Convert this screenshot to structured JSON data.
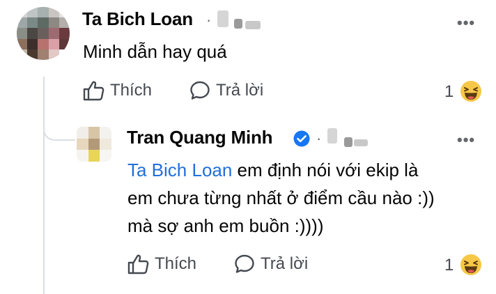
{
  "comment": {
    "author": "Ta Bich Loan",
    "separator": "·",
    "text": "Minh dẫn hay quá",
    "actions": {
      "like_label": "Thích",
      "reply_label": "Trả lời"
    },
    "reaction_count": "1",
    "more_label": "•••"
  },
  "reply": {
    "author": "Tran Quang Minh",
    "separator": "·",
    "mention": "Ta Bich Loan",
    "text_line1": " em định nói với ekip là",
    "text_line2": "em chưa từng nhất ở điểm cầu nào :))",
    "text_line3": "mà sợ anh em buồn :))))",
    "actions": {
      "like_label": "Thích",
      "reply_label": "Trả lời"
    },
    "reaction_count": "1",
    "more_label": "•••"
  },
  "colors": {
    "text": "#050505",
    "secondary": "#65676b",
    "mention": "#216fdb",
    "verified_badge": "#1877f2"
  },
  "icons": [
    "thumbs-up-icon",
    "speech-bubble-icon",
    "laughing-emoji-icon",
    "verified-badge-icon"
  ]
}
